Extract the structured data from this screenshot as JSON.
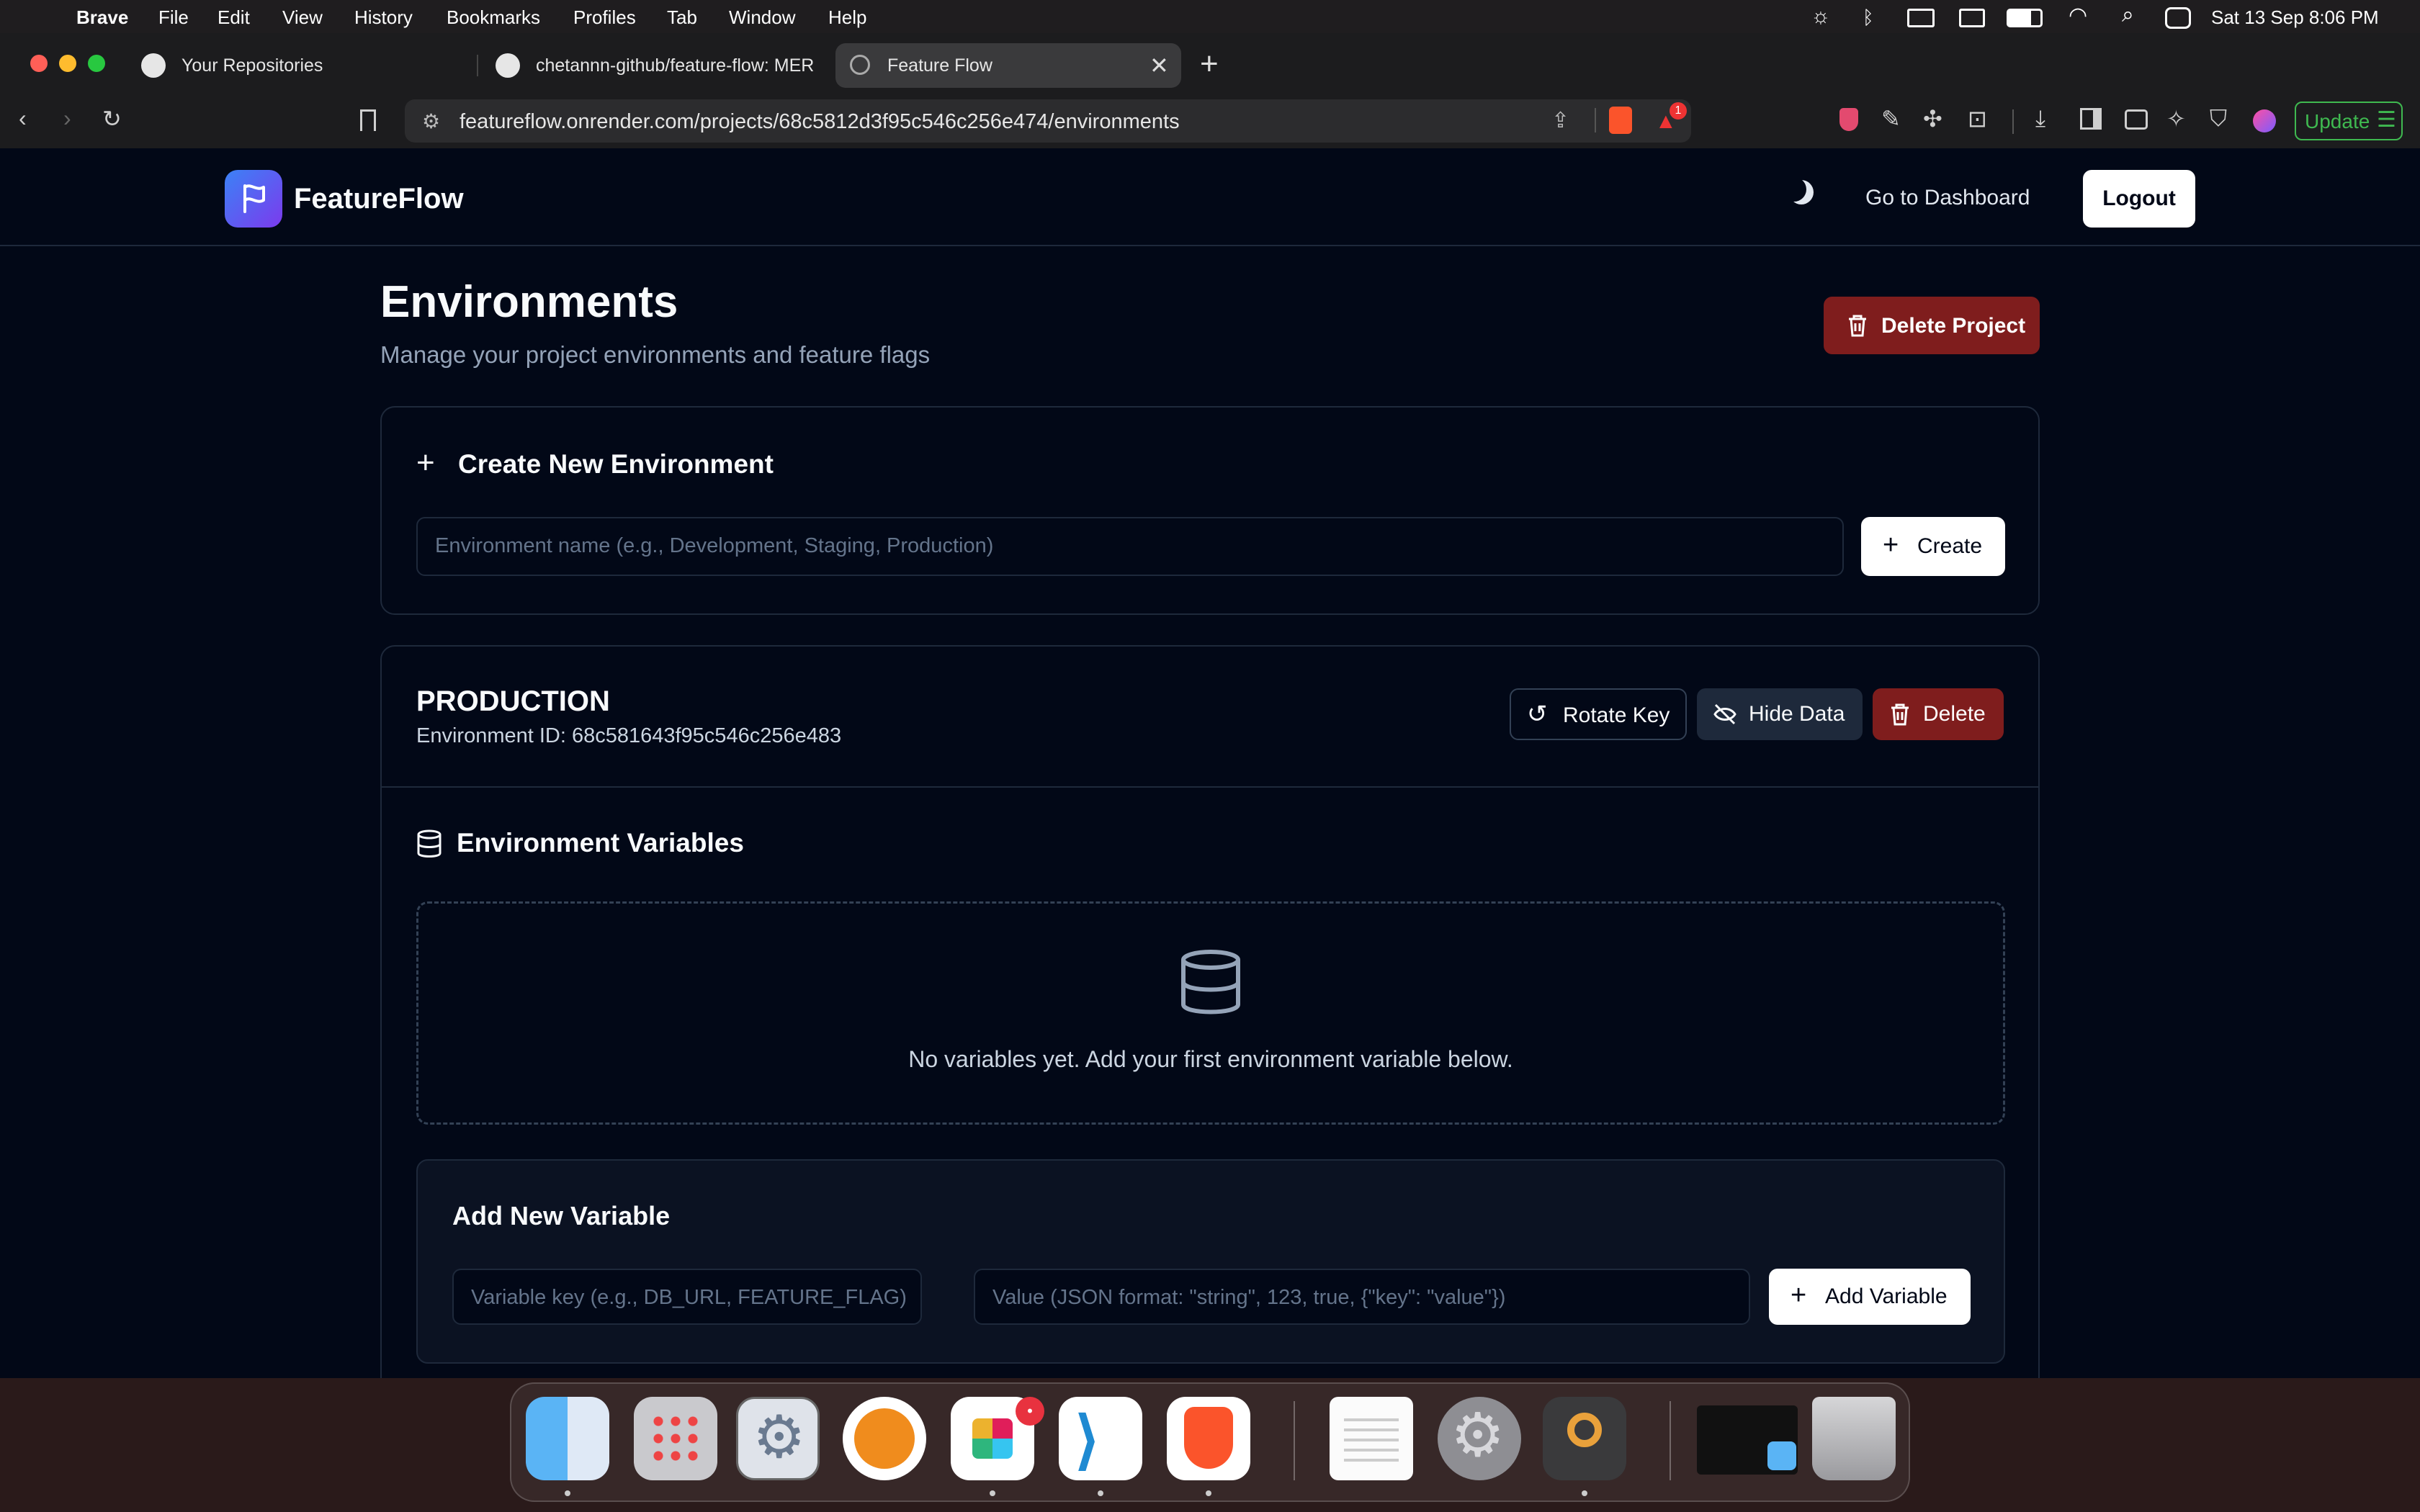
{
  "menubar": {
    "app_name": "Brave",
    "items": [
      "File",
      "Edit",
      "View",
      "History",
      "Bookmarks",
      "Profiles",
      "Tab",
      "Window",
      "Help"
    ],
    "clock": "Sat 13 Sep  8:06 PM"
  },
  "tabs": [
    {
      "title": "Your Repositories",
      "icon": "github-icon"
    },
    {
      "title": "chetannn-github/feature-flow: MER",
      "icon": "github-icon"
    },
    {
      "title": "Feature Flow",
      "icon": "globe-icon",
      "active": true
    }
  ],
  "toolbar": {
    "url": "featureflow.onrender.com/projects/68c5812d3f95c546c256e474/environments",
    "update_label": "Update",
    "shields_badge": "1"
  },
  "app": {
    "brand": "FeatureFlow",
    "nav": {
      "dashboard": "Go to Dashboard",
      "logout": "Logout"
    },
    "page_title": "Environments",
    "page_subtitle": "Manage your project environments and feature flags",
    "delete_project_label": "Delete Project",
    "create_section": {
      "title": "Create New Environment",
      "placeholder": "Environment name (e.g., Development, Staging, Production)",
      "create_label": "Create"
    },
    "environment": {
      "name": "PRODUCTION",
      "id_line": "Environment ID: 68c581643f95c546c256e483",
      "rotate_label": "Rotate Key",
      "hide_label": "Hide Data",
      "delete_label": "Delete",
      "variables_title": "Environment Variables",
      "empty_text": "No variables yet. Add your first environment variable below.",
      "add_title": "Add New Variable",
      "key_placeholder": "Variable key (e.g., DB_URL, FEATURE_FLAG)",
      "value_placeholder": "Value (JSON format: \"string\", 123, true, {\"key\": \"value\"})",
      "add_label": "Add Variable"
    }
  },
  "dock": {
    "apps": [
      "finder",
      "launchpad",
      "settings-gear",
      "openvpn",
      "slack",
      "vscode",
      "brave",
      "textedit",
      "system-settings",
      "keychain",
      "window-preview",
      "trash"
    ],
    "slack_badge": "•"
  },
  "colors": {
    "page_bg": "#020817",
    "danger": "#7f1d1d",
    "brand_gradient_start": "#3b82f6",
    "brand_gradient_end": "#7c3aed",
    "update_green": "#3fb950"
  }
}
